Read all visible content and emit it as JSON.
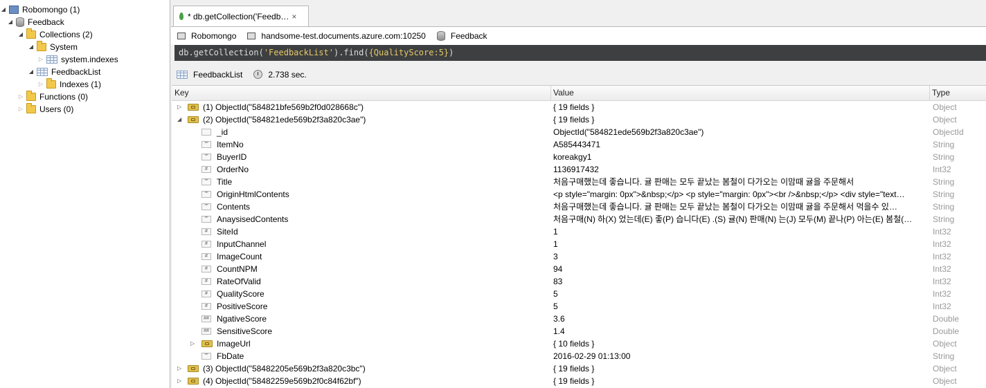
{
  "explorer": {
    "items": [
      {
        "label": "Robomongo (1)",
        "icon": "computer-icon"
      },
      {
        "label": "Feedback",
        "icon": "database-icon"
      },
      {
        "label": "Collections (2)",
        "icon": "folder-icon"
      },
      {
        "label": "System",
        "icon": "folder-icon"
      },
      {
        "label": "system.indexes",
        "icon": "collection-icon"
      },
      {
        "label": "FeedbackList",
        "icon": "collection-icon"
      },
      {
        "label": "Indexes (1)",
        "icon": "folder-icon"
      },
      {
        "label": "Functions (0)",
        "icon": "folder-icon"
      },
      {
        "label": "Users (0)",
        "icon": "folder-icon"
      }
    ]
  },
  "tab": {
    "label": "* db.getCollection('Feedb…",
    "close": "×"
  },
  "info": {
    "server": "Robomongo",
    "host": "handsome-test.documents.azure.com:10250",
    "database": "Feedback"
  },
  "query": {
    "p1": "db.getCollection(",
    "p2": "'FeedbackList'",
    "p3": ").find(",
    "p4": "{QualityScore:5}",
    "p5": ")"
  },
  "result": {
    "collection": "FeedbackList",
    "time": "2.738 sec."
  },
  "columns": {
    "key": "Key",
    "value": "Value",
    "type": "Type"
  },
  "rows": [
    {
      "key": "(1) ObjectId(\"584821bfe569b2f0d028668c\")",
      "value": "{ 19 fields }",
      "type": "Object",
      "icon": "document-icon"
    },
    {
      "key": "(2) ObjectId(\"584821ede569b2f3a820c3ae\")",
      "value": "{ 19 fields }",
      "type": "Object",
      "icon": "document-icon"
    },
    {
      "key": "_id",
      "value": "ObjectId(\"584821ede569b2f3a820c3ae\")",
      "type": "ObjectId",
      "icon": "objectid-icon"
    },
    {
      "key": "ItemNo",
      "value": "A585443471",
      "type": "String",
      "icon": "string-icon"
    },
    {
      "key": "BuyerID",
      "value": "koreakgy1",
      "type": "String",
      "icon": "string-icon"
    },
    {
      "key": "OrderNo",
      "value": "1136917432",
      "type": "Int32",
      "icon": "int-icon"
    },
    {
      "key": "Title",
      "value": "처음구매했는데 좋습니다. 귤 판매는 모두 끝났는 봄철이 다가오는 이맘때 귤을 주문해서",
      "type": "String",
      "icon": "string-icon"
    },
    {
      "key": "OriginHtmlContents",
      "value": "<p style=\"margin: 0px\">&nbsp;</p>  <p style=\"margin: 0px\"><br />&nbsp;</p>  <div style=\"text…",
      "type": "String",
      "icon": "string-icon"
    },
    {
      "key": "Contents",
      "value": "처음구매했는데 좋습니다. 귤 판매는 모두 끝났는 봄철이 다가오는 이맘때 귤을 주문해서 먹을수 있…",
      "type": "String",
      "icon": "string-icon"
    },
    {
      "key": "AnaysisedContents",
      "value": "처음구매(N) 하(X) 었는데(E) 좋(P) 습니다(E) .(S) 귤(N) 판매(N) 는(J) 모두(M) 끝나(P) 아는(E) 봄철(…",
      "type": "String",
      "icon": "string-icon"
    },
    {
      "key": "SiteId",
      "value": "1",
      "type": "Int32",
      "icon": "int-icon"
    },
    {
      "key": "InputChannel",
      "value": "1",
      "type": "Int32",
      "icon": "int-icon"
    },
    {
      "key": "ImageCount",
      "value": "3",
      "type": "Int32",
      "icon": "int-icon"
    },
    {
      "key": "CountNPM",
      "value": "94",
      "type": "Int32",
      "icon": "int-icon"
    },
    {
      "key": "RateOfValid",
      "value": "83",
      "type": "Int32",
      "icon": "int-icon"
    },
    {
      "key": "QualityScore",
      "value": "5",
      "type": "Int32",
      "icon": "int-icon"
    },
    {
      "key": "PositiveScore",
      "value": "5",
      "type": "Int32",
      "icon": "int-icon"
    },
    {
      "key": "NgativeScore",
      "value": "3.6",
      "type": "Double",
      "icon": "double-icon"
    },
    {
      "key": "SensitiveScore",
      "value": "1.4",
      "type": "Double",
      "icon": "double-icon"
    },
    {
      "key": "ImageUrl",
      "value": "{ 10 fields }",
      "type": "Object",
      "icon": "document-icon"
    },
    {
      "key": "FbDate",
      "value": "2016-02-29 01:13:00",
      "type": "String",
      "icon": "string-icon"
    },
    {
      "key": "(3) ObjectId(\"58482205e569b2f3a820c3bc\")",
      "value": "{ 19 fields }",
      "type": "Object",
      "icon": "document-icon"
    },
    {
      "key": "(4) ObjectId(\"58482259e569b2f0c84f62bf\")",
      "value": "{ 19 fields }",
      "type": "Object",
      "icon": "document-icon"
    }
  ]
}
